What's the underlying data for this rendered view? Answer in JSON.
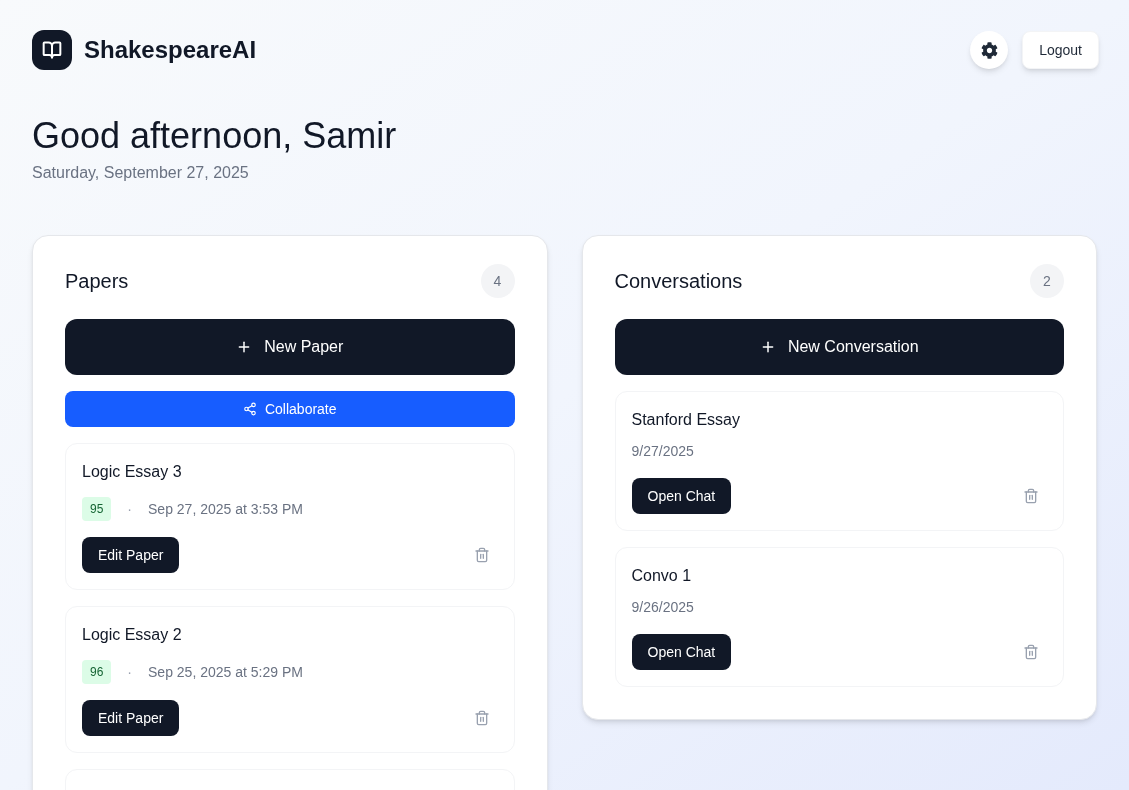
{
  "header": {
    "app_name": "ShakespeareAI",
    "logout_button": "Logout"
  },
  "greeting": {
    "title": "Good afternoon, Samir",
    "date": "Saturday, September 27, 2025"
  },
  "papers": {
    "title": "Papers",
    "count": "4",
    "new_button": "New Paper",
    "collaborate_button": "Collaborate",
    "items": [
      {
        "title": "Logic Essay 3",
        "score": "95",
        "separator": "·",
        "updated": "Sep 27, 2025 at 3:53 PM",
        "action": "Edit Paper"
      },
      {
        "title": "Logic Essay 2",
        "score": "96",
        "separator": "·",
        "updated": "Sep 25, 2025 at 5:29 PM",
        "action": "Edit Paper"
      }
    ]
  },
  "conversations": {
    "title": "Conversations",
    "count": "2",
    "new_button": "New Conversation",
    "items": [
      {
        "title": "Stanford Essay",
        "date": "9/27/2025",
        "action": "Open Chat"
      },
      {
        "title": "Convo 1",
        "date": "9/26/2025",
        "action": "Open Chat"
      }
    ]
  }
}
